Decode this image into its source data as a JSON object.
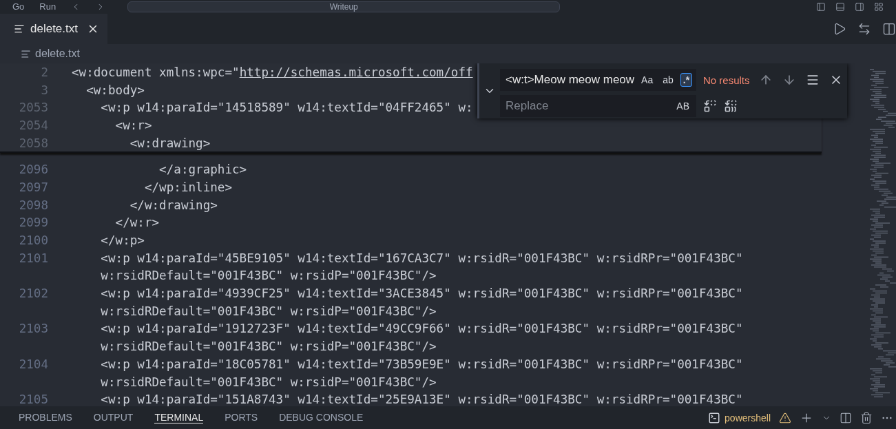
{
  "title_bar": {
    "menu": [
      "Go",
      "Run"
    ],
    "search": "Writeup"
  },
  "tabs": [
    {
      "label": "delete.txt",
      "selected": true
    }
  ],
  "breadcrumb": "delete.txt",
  "sticky_lines": [
    {
      "number": "2",
      "text": "<w:document xmlns:wpc=\"",
      "link": "http://schemas.microsoft.com/off"
    },
    {
      "number": "3",
      "text": "  <w:body>"
    },
    {
      "number": "2053",
      "text": "    <w:p w14:paraId=\"14518589\" w14:textId=\"04FF2465\" w:"
    },
    {
      "number": "2054",
      "text": "      <w:r>"
    },
    {
      "number": "2058",
      "text": "        <w:drawing>"
    }
  ],
  "lines": [
    {
      "number": "2096",
      "text": "            </a:graphic>"
    },
    {
      "number": "2097",
      "text": "          </wp:inline>"
    },
    {
      "number": "2098",
      "text": "        </w:drawing>"
    },
    {
      "number": "2099",
      "text": "      </w:r>"
    },
    {
      "number": "2100",
      "text": "    </w:p>"
    },
    {
      "number": "2101",
      "text": "    <w:p w14:paraId=\"45BE9105\" w14:textId=\"167CA3C7\" w:rsidR=\"001F43BC\" w:rsidRPr=\"001F43BC\"",
      "continuation": "    w:rsidRDefault=\"001F43BC\" w:rsidP=\"001F43BC\"/>"
    },
    {
      "number": "2102",
      "text": "    <w:p w14:paraId=\"4939CF25\" w14:textId=\"3ACE3845\" w:rsidR=\"001F43BC\" w:rsidRPr=\"001F43BC\"",
      "continuation": "    w:rsidRDefault=\"001F43BC\" w:rsidP=\"001F43BC\"/>"
    },
    {
      "number": "2103",
      "text": "    <w:p w14:paraId=\"1912723F\" w14:textId=\"49CC9F66\" w:rsidR=\"001F43BC\" w:rsidRPr=\"001F43BC\"",
      "continuation": "    w:rsidRDefault=\"001F43BC\" w:rsidP=\"001F43BC\"/>"
    },
    {
      "number": "2104",
      "text": "    <w:p w14:paraId=\"18C05781\" w14:textId=\"73B59E9E\" w:rsidR=\"001F43BC\" w:rsidRPr=\"001F43BC\"",
      "continuation": "    w:rsidRDefault=\"001F43BC\" w:rsidP=\"001F43BC\"/>"
    },
    {
      "number": "2105",
      "text": "    <w:p w14:paraId=\"151A8743\" w14:textId=\"25E9A13E\" w:rsidR=\"001F43BC\" w:rsidRPr=\"001F43BC\""
    }
  ],
  "find_widget": {
    "expanded": true,
    "value": "<w:t>Meow meow meow",
    "options": [
      {
        "label": "Aa",
        "selected": false
      },
      {
        "label": "ab",
        "selected": false
      },
      {
        "label": ".*",
        "selected": true
      }
    ],
    "status": "No results",
    "replace_placeholder": "Replace",
    "replace_options": [
      {
        "label": "AB",
        "selected": false
      }
    ]
  },
  "panel": {
    "tabs": [
      {
        "label": "PROBLEMS",
        "selected": false
      },
      {
        "label": "OUTPUT",
        "selected": false
      },
      {
        "label": "TERMINAL",
        "selected": true
      },
      {
        "label": "PORTS",
        "selected": false
      },
      {
        "label": "DEBUG CONSOLE",
        "selected": false
      }
    ],
    "terminal": "powershell"
  }
}
